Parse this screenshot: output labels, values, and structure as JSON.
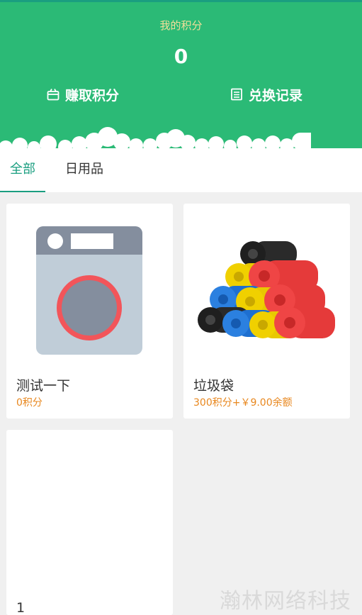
{
  "header": {
    "points_label": "我的积分",
    "points_value": "0",
    "earn_label": "赚取积分",
    "record_label": "兑换记录",
    "earn_icon": "gift-icon",
    "record_icon": "list-icon",
    "bg_color": "#2bba76",
    "label_color": "#f2df9a"
  },
  "tabs": [
    {
      "label": "全部",
      "active": true
    },
    {
      "label": "日用品",
      "active": false
    }
  ],
  "products": [
    {
      "name": "测试一下",
      "price": "0积分",
      "image": "washing-machine-icon"
    },
    {
      "name": "垃圾袋",
      "price": "300积分+￥9.00余额",
      "image": "garbage-bags-image"
    },
    {
      "name": "1",
      "price": "",
      "image": ""
    }
  ],
  "watermark": "瀚林网络科技",
  "colors": {
    "accent": "#1a9e80",
    "price": "#e8871e"
  }
}
